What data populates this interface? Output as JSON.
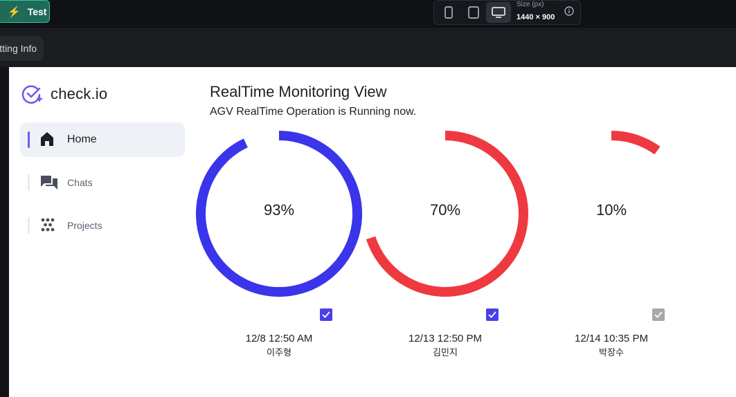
{
  "editor": {
    "test_label": "Test",
    "size_label": "Size (px)",
    "size_value": "1440 × 900",
    "setting_info_label": "Setting Info"
  },
  "app": {
    "brand": "check.io",
    "title": "RealTime Monitoring View",
    "subtitle": "AGV RealTime Operation is Running now."
  },
  "sidebar": {
    "items": [
      {
        "label": "Home",
        "icon": "home-icon",
        "active": true
      },
      {
        "label": "Chats",
        "icon": "chats-icon",
        "active": false
      },
      {
        "label": "Projects",
        "icon": "projects-icon",
        "active": false
      }
    ]
  },
  "gauges": [
    {
      "percent_label": "93%",
      "value": 93,
      "color": "#3a34ea",
      "checked": true,
      "check_color": "#4840e6",
      "date": "12/8 12:50 AM",
      "person": "이주형"
    },
    {
      "percent_label": "70%",
      "value": 70,
      "color": "#ee3940",
      "checked": true,
      "check_color": "#4840e6",
      "date": "12/13 12:50 PM",
      "person": "김민지"
    },
    {
      "percent_label": "10%",
      "value": 10,
      "color": "#ee3940",
      "checked": true,
      "check_color": "#a8a8a8",
      "date": "12/14 10:35 PM",
      "person": "박장수"
    }
  ],
  "colors": {
    "accent": "#6b5cf0",
    "blue": "#3a34ea",
    "red": "#ee3940"
  }
}
